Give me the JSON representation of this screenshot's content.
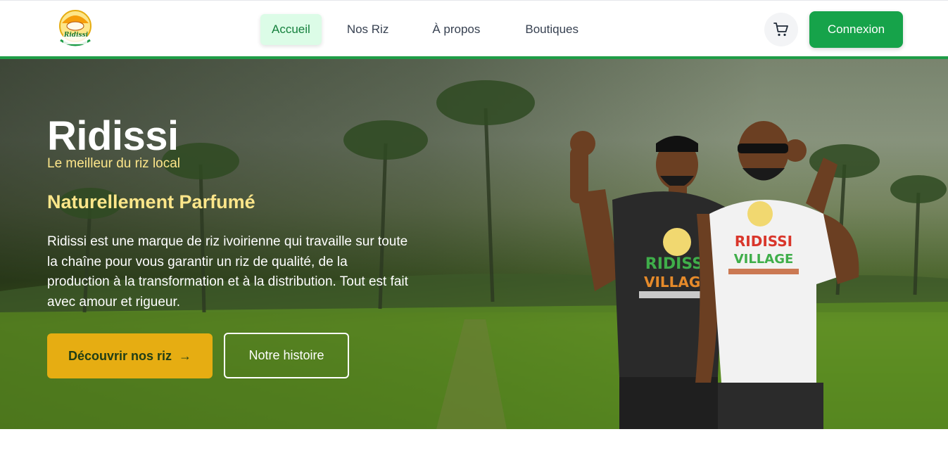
{
  "header": {
    "logo": {
      "name": "Ridissi",
      "icon": "ridissi-logo"
    },
    "nav": [
      {
        "label": "Accueil",
        "active": true
      },
      {
        "label": "Nos Riz",
        "active": false
      },
      {
        "label": "À propos",
        "active": false
      },
      {
        "label": "Boutiques",
        "active": false
      }
    ],
    "cart_icon": "shopping-cart-icon",
    "login_label": "Connexion"
  },
  "hero": {
    "title": "Ridissi",
    "tagline": "Le meilleur du riz local",
    "subtitle": "Naturellement Parfumé",
    "description": "Ridissi est une marque de riz ivoirienne qui travaille sur toute la chaîne pour vous garantir un riz de qualité, de la production à la transformation et à la distribution. Tout est fait avec amour et rigueur.",
    "primary_button": "Découvrir nos riz",
    "primary_button_icon": "arrow-right-icon",
    "secondary_button": "Notre histoire",
    "tshirt_left": [
      "RIDISSI",
      "VILLAGE"
    ],
    "tshirt_right": [
      "RIDISSI",
      "VILLAGE"
    ]
  },
  "colors": {
    "brand_green": "#16a34a",
    "header_border": "#1f9d47",
    "accent_yellow": "#e6ad12",
    "tagline_yellow": "#fde68a",
    "active_nav_bg": "#dcfce7"
  }
}
